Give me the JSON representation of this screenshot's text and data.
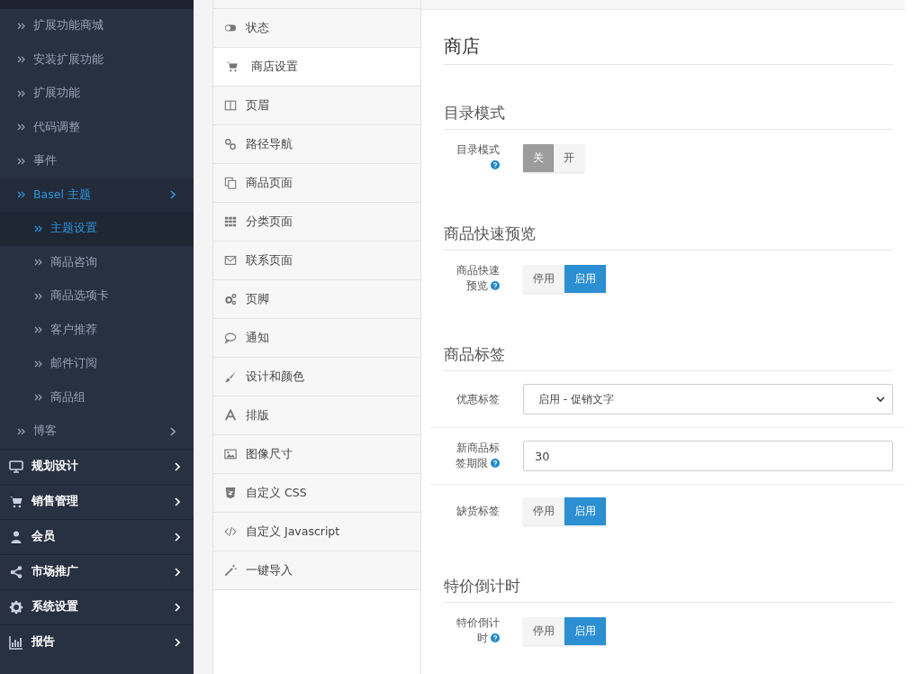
{
  "sidebar": {
    "items": [
      {
        "label": "扩展功能商城",
        "kind": "sub",
        "selected": false
      },
      {
        "label": "安装扩展功能",
        "kind": "sub",
        "selected": false
      },
      {
        "label": "扩展功能",
        "kind": "sub",
        "selected": false
      },
      {
        "label": "代码调整",
        "kind": "sub",
        "selected": false
      },
      {
        "label": "事件",
        "kind": "sub",
        "selected": false
      },
      {
        "label": "Basel 主题",
        "kind": "sub",
        "selected": false,
        "expanded": true,
        "children": [
          {
            "label": "主题设置",
            "selected": true
          },
          {
            "label": "商品咨询",
            "selected": false
          },
          {
            "label": "商品选项卡",
            "selected": false
          },
          {
            "label": "客户推荐",
            "selected": false
          },
          {
            "label": "邮件订阅",
            "selected": false
          },
          {
            "label": "商品组",
            "selected": false
          }
        ]
      },
      {
        "label": "博客",
        "kind": "sub",
        "selected": false,
        "expanded": false
      },
      {
        "label": "规划设计",
        "kind": "main",
        "selected": false
      },
      {
        "label": "销售管理",
        "kind": "main",
        "selected": false
      },
      {
        "label": "会员",
        "kind": "main",
        "selected": false
      },
      {
        "label": "市场推广",
        "kind": "main",
        "selected": false
      },
      {
        "label": "系统设置",
        "kind": "main",
        "selected": false
      },
      {
        "label": "报告",
        "kind": "main",
        "selected": false
      }
    ]
  },
  "tabs": [
    {
      "label": "状态",
      "selected": false
    },
    {
      "label": "商店设置",
      "selected": true
    },
    {
      "label": "页眉",
      "selected": false
    },
    {
      "label": "路径导航",
      "selected": false
    },
    {
      "label": "商品页面",
      "selected": false
    },
    {
      "label": "分类页面",
      "selected": false
    },
    {
      "label": "联系页面",
      "selected": false
    },
    {
      "label": "页脚",
      "selected": false
    },
    {
      "label": "通知",
      "selected": false
    },
    {
      "label": "设计和颜色",
      "selected": false
    },
    {
      "label": "排版",
      "selected": false
    },
    {
      "label": "图像尺寸",
      "selected": false
    },
    {
      "label": "自定义 CSS",
      "selected": false
    },
    {
      "label": "自定义 Javascript",
      "selected": false
    },
    {
      "label": "一键导入",
      "selected": false
    }
  ],
  "content": {
    "title": "商店",
    "sections": [
      {
        "title": "目录模式",
        "fields": [
          {
            "label": "目录模式",
            "help": true,
            "kind": "toggle",
            "options": [
              {
                "label": "关",
                "kind": "off",
                "selected": true
              },
              {
                "label": "开",
                "kind": "on",
                "selected": false
              }
            ]
          }
        ]
      },
      {
        "title": "商品快速预览",
        "fields": [
          {
            "label": "商品快速预览",
            "help": true,
            "kind": "toggle",
            "options": [
              {
                "label": "停用",
                "kind": "off",
                "selected": false
              },
              {
                "label": "启用",
                "kind": "on",
                "selected": true
              }
            ]
          }
        ]
      },
      {
        "title": "商品标签",
        "fields": [
          {
            "label": "优惠标签",
            "help": false,
            "kind": "select",
            "value": "启用 - 促销文字"
          },
          {
            "label": "新商品标签期限",
            "help": true,
            "kind": "text",
            "value": "30"
          },
          {
            "label": "缺货标签",
            "help": false,
            "kind": "toggle",
            "options": [
              {
                "label": "停用",
                "kind": "off",
                "selected": false
              },
              {
                "label": "启用",
                "kind": "on",
                "selected": true
              }
            ]
          }
        ]
      },
      {
        "title": "特价倒计时",
        "fields": [
          {
            "label": "特价倒计时",
            "help": true,
            "kind": "toggle",
            "options": [
              {
                "label": "停用",
                "kind": "off",
                "selected": false
              },
              {
                "label": "启用",
                "kind": "on",
                "selected": true
              }
            ]
          }
        ]
      }
    ]
  }
}
